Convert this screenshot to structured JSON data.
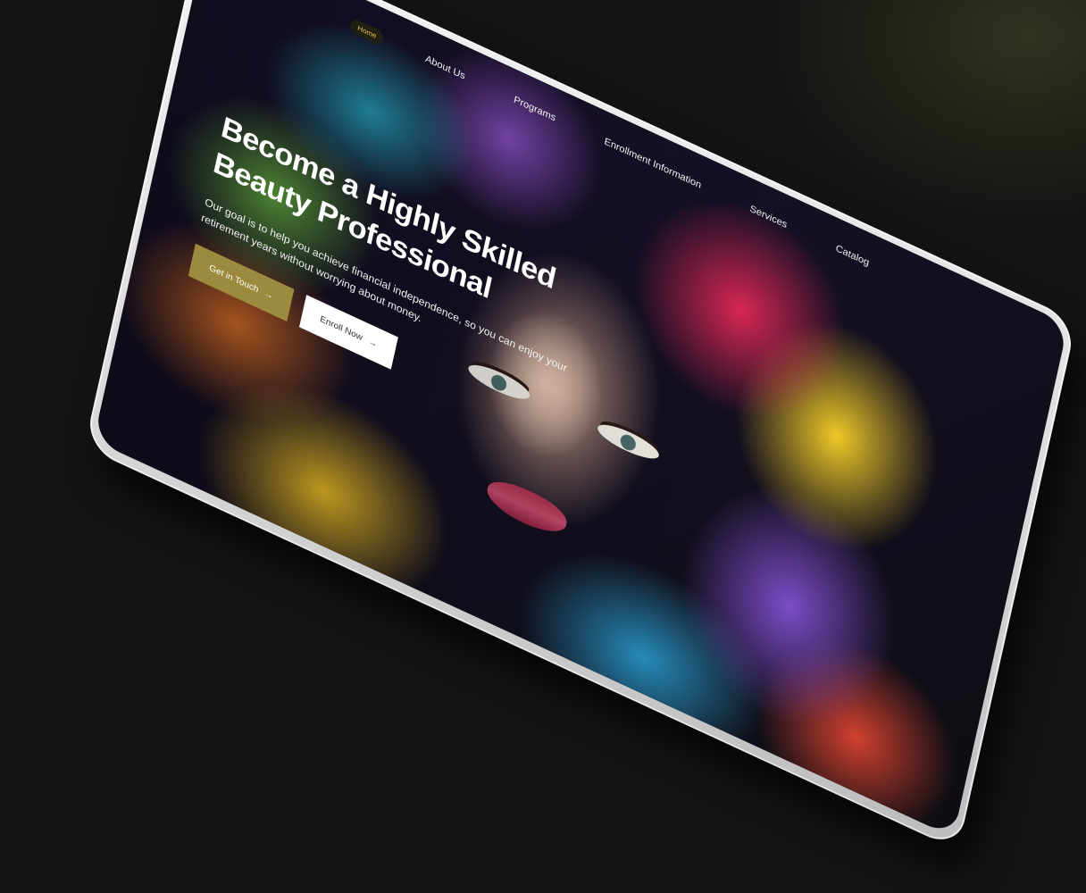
{
  "nav": {
    "links": [
      {
        "label": "Home",
        "active": true
      },
      {
        "label": "About Us",
        "active": false
      },
      {
        "label": "Programs",
        "active": false
      },
      {
        "label": "Enrollment Information",
        "active": false
      },
      {
        "label": "Services",
        "active": false
      },
      {
        "label": "Catalog",
        "active": false
      }
    ]
  },
  "hero": {
    "headline_line1": "Become a Highly Skilled",
    "headline_line2": "Beauty Professional",
    "subtext": "Our goal is to help you achieve financial independence, so you can enjoy your retirement years without worrying about money.",
    "primary_cta": "Get in Touch",
    "secondary_cta": "Enroll Now",
    "arrow_icon": "→"
  },
  "colors": {
    "accent": "#9c8a3e",
    "background": "#141414"
  }
}
